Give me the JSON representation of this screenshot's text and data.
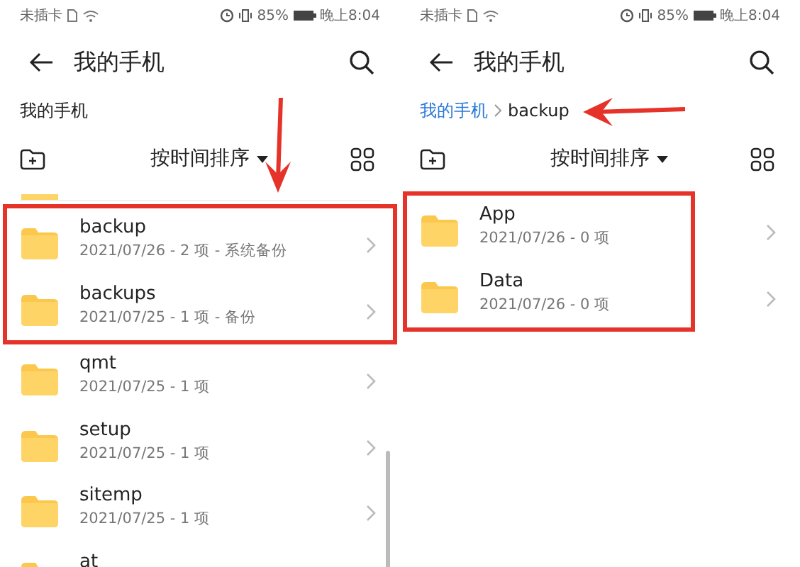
{
  "panels": [
    {
      "status_bar": {
        "carrier": "未插卡",
        "battery": "85%",
        "time": "晚上8:04"
      },
      "title": "我的手机",
      "breadcrumb": [
        {
          "label": "我的手机",
          "selected": true
        }
      ],
      "sort_label": "按时间排序",
      "partial_row": true,
      "scrollbar": true,
      "annotation": {
        "kind": "down"
      },
      "highlighted_items": [
        {
          "name": "backup",
          "details": "2021/07/26 - 2 项 - 系统备份"
        },
        {
          "name": "backups",
          "details": "2021/07/25 - 1 项 - 备份"
        }
      ],
      "items": [
        {
          "name": "qmt",
          "details": "2021/07/25 - 1 项"
        },
        {
          "name": "setup",
          "details": "2021/07/25 - 1 项"
        },
        {
          "name": "sitemp",
          "details": "2021/07/25 - 1 项"
        },
        {
          "name": "at"
        }
      ]
    },
    {
      "status_bar": {
        "carrier": "未插卡",
        "battery": "85%",
        "time": "晚上8:04"
      },
      "title": "我的手机",
      "breadcrumb": [
        {
          "label": "我的手机",
          "selected": false
        },
        {
          "label": "backup",
          "selected": true
        }
      ],
      "sort_label": "按时间排序",
      "annotation": {
        "kind": "left"
      },
      "highlighted_items": [
        {
          "name": "App",
          "details": "2021/07/26 - 0 项"
        },
        {
          "name": "Data",
          "details": "2021/07/26 - 0 项"
        }
      ]
    }
  ]
}
